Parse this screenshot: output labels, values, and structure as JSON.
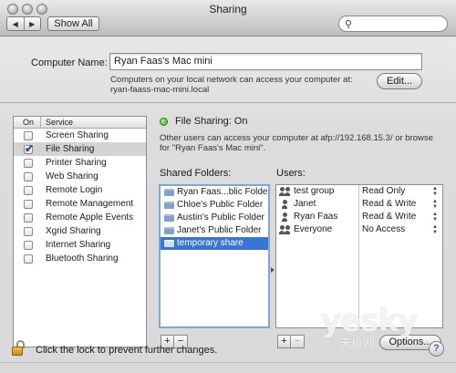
{
  "window": {
    "title": "Sharing"
  },
  "toolbar": {
    "back_icon": "back-arrow-icon",
    "forward_icon": "forward-arrow-icon",
    "show_all_label": "Show All",
    "search_placeholder": ""
  },
  "computer_name": {
    "label": "Computer Name:",
    "value": "Ryan Faas's Mac mini",
    "help_text": "Computers on your local network can access your computer at: ryan-faass-mac-mini.local",
    "edit_label": "Edit..."
  },
  "services": {
    "header_on": "On",
    "header_service": "Service",
    "items": [
      {
        "label": "Screen Sharing",
        "checked": false
      },
      {
        "label": "File Sharing",
        "checked": true
      },
      {
        "label": "Printer Sharing",
        "checked": false
      },
      {
        "label": "Web Sharing",
        "checked": false
      },
      {
        "label": "Remote Login",
        "checked": false
      },
      {
        "label": "Remote Management",
        "checked": false
      },
      {
        "label": "Remote Apple Events",
        "checked": false
      },
      {
        "label": "Xgrid Sharing",
        "checked": false
      },
      {
        "label": "Internet Sharing",
        "checked": false
      },
      {
        "label": "Bluetooth Sharing",
        "checked": false
      }
    ]
  },
  "file_sharing": {
    "status": "File Sharing: On",
    "status_color": "#3aa020",
    "help_text": "Other users can access your computer at afp://192.168.15.3/ or browse for \"Ryan Faas's Mac mini\"."
  },
  "shared_folders": {
    "label": "Shared Folders:",
    "items": [
      "Ryan Faas...blic Folder",
      "Chloe's Public Folder",
      "Austin's Public Folder",
      "Janet's Public Folder",
      "temporary share"
    ]
  },
  "users": {
    "label": "Users:",
    "items": [
      {
        "name": "test group",
        "permission": "Read Only"
      },
      {
        "name": "Janet",
        "permission": "Read & Write"
      },
      {
        "name": "Ryan Faas",
        "permission": "Read & Write"
      },
      {
        "name": "Everyone",
        "permission": "No Access"
      }
    ]
  },
  "buttons": {
    "add": "+",
    "remove": "−",
    "options": "Options..."
  },
  "footer": {
    "lock_text": "Click the lock to prevent further changes.",
    "help": "?"
  },
  "watermark": {
    "main": "yesky",
    "sub": "天极网"
  }
}
